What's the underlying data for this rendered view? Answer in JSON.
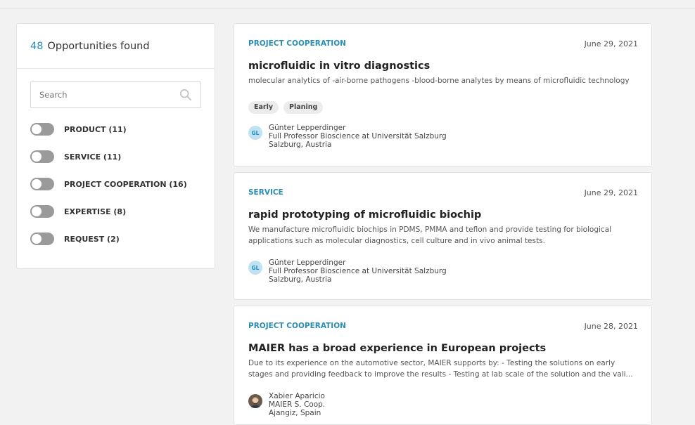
{
  "sidebar": {
    "count": "48",
    "count_label": "Opportunities found",
    "search_placeholder": "Search",
    "filters": [
      {
        "label": "PRODUCT (11)"
      },
      {
        "label": "SERVICE (11)"
      },
      {
        "label": "PROJECT COOPERATION (16)"
      },
      {
        "label": "EXPERTISE (8)"
      },
      {
        "label": "REQUEST (2)"
      }
    ]
  },
  "cards": [
    {
      "category": "PROJECT COOPERATION",
      "date": "June 29, 2021",
      "title": "microfluidic in vitro diagnostics",
      "description": "molecular analytics of -air-borne pathogens -blood-borne analytes by means of microfluidic technology",
      "tags": [
        "Early",
        "Planing"
      ],
      "author": {
        "initials": "GL",
        "name": "Günter Lepperdinger",
        "position": "Full Professor Bioscience at Universität Salzburg",
        "location": "Salzburg, Austria"
      }
    },
    {
      "category": "SERVICE",
      "date": "June 29, 2021",
      "title": "rapid prototyping of microfluidic biochip",
      "description": "We manufacture microfluidic biochips in PDMS, PMMA and teflon and provide testing for biological applications such as molecular diagnostics, cell culture and in vivo animal tests.",
      "author": {
        "initials": "GL",
        "name": "Günter Lepperdinger",
        "position": "Full Professor Bioscience at Universität Salzburg",
        "location": "Salzburg, Austria"
      }
    },
    {
      "category": "PROJECT COOPERATION",
      "date": "June 28, 2021",
      "title": "MAIER has a broad experience in European projects",
      "description": "Due to its experience on the automotive sector, MAIER supports by: - Testing the solutions on early stages and providing feedback to improve the results - Testing at lab scale of the solution and the vali...",
      "author": {
        "name": "Xabier Aparicio",
        "position": "MAIER S. Coop.",
        "location": "Ajangiz, Spain"
      }
    }
  ],
  "colors": {
    "accent": "#2a8db4",
    "toggle_off": "#9a9a9a",
    "background": "#f2f2f2"
  }
}
